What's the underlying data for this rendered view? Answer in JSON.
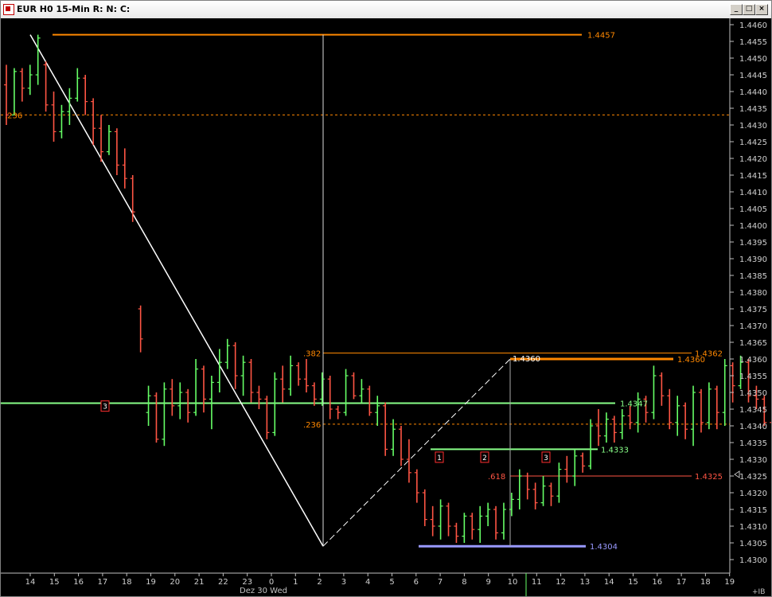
{
  "window": {
    "title": "EUR H0 15-Min R: N: C:",
    "minimize_label": "_",
    "maximize_label": "□",
    "close_label": "×"
  },
  "chart_data": {
    "type": "ohlc",
    "symbol": "EUR H0",
    "interval": "15-Min",
    "y_axis": {
      "range": [
        1.42995,
        1.44635
      ],
      "ticks": [
        "1.4460",
        "1.4455",
        "1.4450",
        "1.4445",
        "1.4440",
        "1.4435",
        "1.4430",
        "1.4425",
        "1.4420",
        "1.4415",
        "1.4410",
        "1.4405",
        "1.4400",
        "1.4395",
        "1.4390",
        "1.4385",
        "1.4380",
        "1.4375",
        "1.4370",
        "1.4365",
        "1.4360",
        "1.4355",
        "1.4350",
        "1.4345",
        "1.4340",
        "1.4335",
        "1.4330",
        "1.4325",
        "1.4320",
        "1.4315",
        "1.4310",
        "1.4305",
        "1.4300"
      ],
      "bottom_label": "+IB"
    },
    "x_axis": {
      "ticks": [
        "14",
        "15",
        "16",
        "17",
        "18",
        "19",
        "20",
        "21",
        "22",
        "23",
        "0",
        "1",
        "2",
        "3",
        "4",
        "5",
        "6",
        "7",
        "8",
        "9",
        "10",
        "11",
        "12",
        "13",
        "14",
        "15",
        "16",
        "17",
        "18",
        "19"
      ],
      "session_label": "Dez 30 Wed"
    },
    "colors": {
      "up": "#66ff66",
      "down": "#ff5544",
      "background": "#000000",
      "trendline": "#ffffff",
      "fib": "#ff8800",
      "support": "#88ff88",
      "target": "#9999ff"
    },
    "bars": [
      [
        1.4442,
        1.4448,
        1.443,
        1.4433
      ],
      [
        1.4433,
        1.4447,
        1.4433,
        1.4446
      ],
      [
        1.4446,
        1.4447,
        1.4437,
        1.4441
      ],
      [
        1.4441,
        1.4448,
        1.4439,
        1.4445
      ],
      [
        1.4445,
        1.4457,
        1.4442,
        1.4456
      ],
      [
        1.4448,
        1.4449,
        1.4434,
        1.4436
      ],
      [
        1.4436,
        1.444,
        1.4425,
        1.4428
      ],
      [
        1.4428,
        1.4436,
        1.4426,
        1.4434
      ],
      [
        1.4434,
        1.4441,
        1.443,
        1.4438
      ],
      [
        1.4438,
        1.4447,
        1.4437,
        1.4444
      ],
      [
        1.4444,
        1.4445,
        1.4433,
        1.4437
      ],
      [
        1.4437,
        1.4438,
        1.4424,
        1.4429
      ],
      [
        1.4429,
        1.4433,
        1.4419,
        1.4422
      ],
      [
        1.4422,
        1.443,
        1.4421,
        1.4428
      ],
      [
        1.4428,
        1.4429,
        1.4415,
        1.4418
      ],
      [
        1.4418,
        1.4423,
        1.4411,
        1.4414
      ],
      [
        1.4414,
        1.4415,
        1.4401,
        1.4404
      ],
      [
        1.4375,
        1.4376,
        1.4362,
        1.4366
      ],
      [
        1.4344,
        1.4352,
        1.434,
        1.4349
      ],
      [
        1.4349,
        1.435,
        1.4335,
        1.4336
      ],
      [
        1.4336,
        1.4353,
        1.4334,
        1.4351
      ],
      [
        1.4351,
        1.4354,
        1.4343,
        1.4346
      ],
      [
        1.4346,
        1.4353,
        1.4342,
        1.435
      ],
      [
        1.435,
        1.4351,
        1.4341,
        1.4344
      ],
      [
        1.4344,
        1.436,
        1.4343,
        1.4357
      ],
      [
        1.4357,
        1.4358,
        1.4344,
        1.4348
      ],
      [
        1.4348,
        1.4355,
        1.4339,
        1.4353
      ],
      [
        1.4353,
        1.4363,
        1.435,
        1.4359
      ],
      [
        1.4359,
        1.4366,
        1.4357,
        1.4364
      ],
      [
        1.4364,
        1.4365,
        1.4351,
        1.4355
      ],
      [
        1.4355,
        1.4361,
        1.4349,
        1.4359
      ],
      [
        1.4359,
        1.436,
        1.4347,
        1.435
      ],
      [
        1.435,
        1.4352,
        1.4345,
        1.4348
      ],
      [
        1.4348,
        1.4349,
        1.4336,
        1.4338
      ],
      [
        1.4338,
        1.4356,
        1.4337,
        1.4354
      ],
      [
        1.4354,
        1.4358,
        1.4347,
        1.4351
      ],
      [
        1.4351,
        1.4361,
        1.4349,
        1.4358
      ],
      [
        1.4358,
        1.4359,
        1.4352,
        1.4354
      ],
      [
        1.4354,
        1.436,
        1.435,
        1.4352
      ],
      [
        1.4352,
        1.4353,
        1.4346,
        1.4348
      ],
      [
        1.4348,
        1.4356,
        1.4346,
        1.4354
      ],
      [
        1.4354,
        1.4355,
        1.4342,
        1.4345
      ],
      [
        1.4345,
        1.4346,
        1.4342,
        1.4344
      ],
      [
        1.4344,
        1.4357,
        1.4343,
        1.4355
      ],
      [
        1.4355,
        1.4356,
        1.4348,
        1.4349
      ],
      [
        1.4349,
        1.4354,
        1.4347,
        1.4351
      ],
      [
        1.4351,
        1.4352,
        1.4343,
        1.4344
      ],
      [
        1.4344,
        1.4349,
        1.434,
        1.4346
      ],
      [
        1.4346,
        1.4347,
        1.4331,
        1.4333
      ],
      [
        1.4333,
        1.4342,
        1.4331,
        1.4339
      ],
      [
        1.4339,
        1.434,
        1.4328,
        1.433
      ],
      [
        1.433,
        1.4336,
        1.4323,
        1.4326
      ],
      [
        1.4326,
        1.4327,
        1.4317,
        1.432
      ],
      [
        1.432,
        1.4321,
        1.431,
        1.4312
      ],
      [
        1.4312,
        1.4316,
        1.4307,
        1.431
      ],
      [
        1.431,
        1.4318,
        1.4306,
        1.4316
      ],
      [
        1.4316,
        1.4317,
        1.4307,
        1.431
      ],
      [
        1.431,
        1.4311,
        1.4305,
        1.4307
      ],
      [
        1.4307,
        1.4314,
        1.4305,
        1.4313
      ],
      [
        1.4313,
        1.4314,
        1.4306,
        1.4309
      ],
      [
        1.4309,
        1.4316,
        1.4305,
        1.4313
      ],
      [
        1.4313,
        1.4317,
        1.431,
        1.4315
      ],
      [
        1.4315,
        1.4316,
        1.4306,
        1.4308
      ],
      [
        1.4308,
        1.4317,
        1.4306,
        1.4315
      ],
      [
        1.4315,
        1.432,
        1.4313,
        1.4318
      ],
      [
        1.4318,
        1.4327,
        1.4315,
        1.4325
      ],
      [
        1.4325,
        1.4326,
        1.4318,
        1.4321
      ],
      [
        1.4321,
        1.4323,
        1.4315,
        1.4317
      ],
      [
        1.4317,
        1.4325,
        1.4316,
        1.4322
      ],
      [
        1.4322,
        1.4323,
        1.4316,
        1.4319
      ],
      [
        1.4319,
        1.4329,
        1.4317,
        1.4327
      ],
      [
        1.4327,
        1.4331,
        1.4323,
        1.4325
      ],
      [
        1.4325,
        1.4333,
        1.4322,
        1.4331
      ],
      [
        1.4331,
        1.4332,
        1.4326,
        1.4328
      ],
      [
        1.4328,
        1.4342,
        1.4327,
        1.434
      ],
      [
        1.434,
        1.4345,
        1.4334,
        1.4337
      ],
      [
        1.4337,
        1.4344,
        1.4335,
        1.4342
      ],
      [
        1.4342,
        1.4343,
        1.4335,
        1.4338
      ],
      [
        1.4338,
        1.4345,
        1.4336,
        1.4343
      ],
      [
        1.4343,
        1.4346,
        1.4339,
        1.4341
      ],
      [
        1.4341,
        1.435,
        1.4338,
        1.4348
      ],
      [
        1.4348,
        1.4349,
        1.4341,
        1.4344
      ],
      [
        1.4344,
        1.4358,
        1.4342,
        1.4355
      ],
      [
        1.4355,
        1.4356,
        1.4346,
        1.4349
      ],
      [
        1.4349,
        1.4351,
        1.4339,
        1.4341
      ],
      [
        1.4341,
        1.4349,
        1.4337,
        1.4346
      ],
      [
        1.4346,
        1.4347,
        1.4336,
        1.4339
      ],
      [
        1.4339,
        1.4352,
        1.4334,
        1.435
      ],
      [
        1.435,
        1.4351,
        1.4338,
        1.4341
      ],
      [
        1.4341,
        1.4353,
        1.4339,
        1.4351
      ],
      [
        1.4351,
        1.4352,
        1.4339,
        1.4344
      ],
      [
        1.4344,
        1.436,
        1.434,
        1.4358
      ],
      [
        1.4358,
        1.4359,
        1.4347,
        1.4352
      ],
      [
        1.4352,
        1.4361,
        1.4351,
        1.4359
      ],
      [
        1.4359,
        1.436,
        1.4347,
        1.4349
      ],
      [
        1.4349,
        1.4352,
        1.4345,
        1.4348
      ],
      [
        1.4348,
        1.4349,
        1.434,
        1.4341
      ],
      [
        1.4341,
        1.4342,
        1.4332,
        1.4334
      ],
      [
        1.4334,
        1.4335,
        1.4327,
        1.4328
      ]
    ],
    "horizontal_levels": [
      {
        "price": 1.4457,
        "label": "1.4457",
        "color": "#ff8800",
        "width": 2
      },
      {
        "price": 1.4433,
        "label": ".236",
        "color": "#ff8800",
        "style": "dashed"
      },
      {
        "price": 1.43618,
        "label": ".382",
        "right_label": "1.4362",
        "color": "#ff8800"
      },
      {
        "price": 1.436,
        "label": "1.4360",
        "color": "#ff8800",
        "width": 3
      },
      {
        "price": 1.43468,
        "label": "1.4347",
        "color": "#88ff88",
        "width": 2
      },
      {
        "price": 1.43405,
        "label": ".236",
        "color": "#ff8800",
        "style": "dashed"
      },
      {
        "price": 1.4333,
        "label": "1.4333",
        "color": "#88ff88",
        "width": 2
      },
      {
        "price": 1.4325,
        "label": ".618",
        "right_label": "1.4325",
        "color": "#ff5544"
      },
      {
        "price": 1.4304,
        "label": "1.4304",
        "color": "#9999ff",
        "width": 3
      }
    ],
    "swing_high_label": "1.4360",
    "count_markers": [
      "3",
      "1",
      "2",
      "3"
    ]
  }
}
